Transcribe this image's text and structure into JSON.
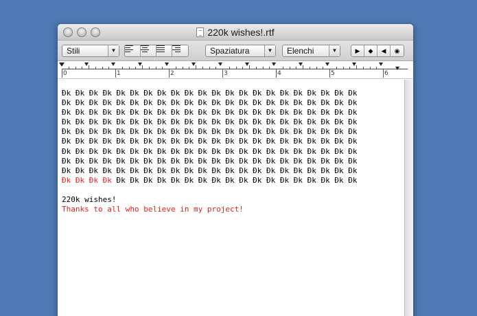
{
  "window": {
    "title": "220k wishes!.rtf"
  },
  "toolbar": {
    "styles_label": "Stili",
    "spacing_label": "Spaziatura",
    "lists_label": "Elenchi"
  },
  "ruler": {
    "numbers": [
      "0",
      "1",
      "2",
      "3",
      "4",
      "5",
      "6"
    ]
  },
  "document": {
    "pattern_token": "Ðk",
    "pattern_rows": 10,
    "pattern_cols": 22,
    "last_row_red_count": 4,
    "line1": "220k wishes!",
    "line2": "Thanks to all who believe in my project!"
  },
  "colors": {
    "desktop": "#4f79b4",
    "red_text": "#e0201e"
  }
}
